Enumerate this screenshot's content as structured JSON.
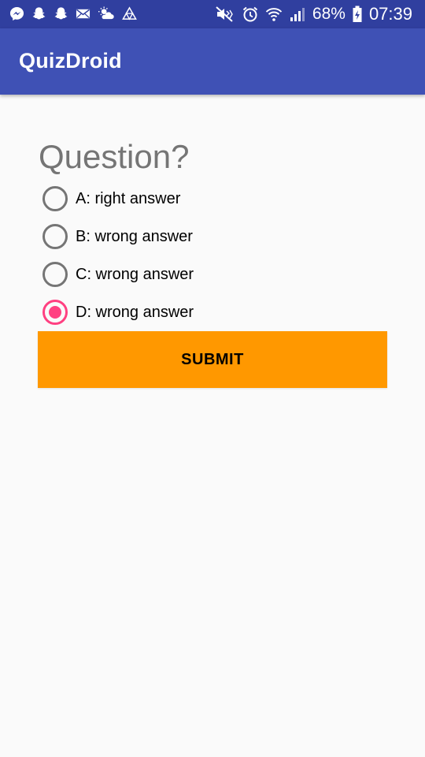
{
  "status_bar": {
    "battery_percent": "68%",
    "time": "07:39",
    "left_icons": [
      "messenger-icon",
      "snapchat-icon",
      "snapchat-icon",
      "email-icon",
      "weather-icon",
      "triangle-app-icon"
    ],
    "right_icons": [
      "mute-icon",
      "alarm-icon",
      "wifi-icon",
      "signal-icon",
      "battery-charging-icon"
    ]
  },
  "app_bar": {
    "title": "QuizDroid"
  },
  "quiz": {
    "question": "Question?",
    "options": [
      {
        "label": "A: right answer",
        "checked": false
      },
      {
        "label": "B: wrong answer",
        "checked": false
      },
      {
        "label": "C: wrong answer",
        "checked": false
      },
      {
        "label": "D: wrong answer",
        "checked": true
      }
    ],
    "submit_label": "SUBMIT"
  },
  "colors": {
    "status_bar": "#303f9f",
    "app_bar": "#3f51b5",
    "accent": "#ff4081",
    "submit_button": "#ff9800",
    "background": "#fafafa"
  }
}
